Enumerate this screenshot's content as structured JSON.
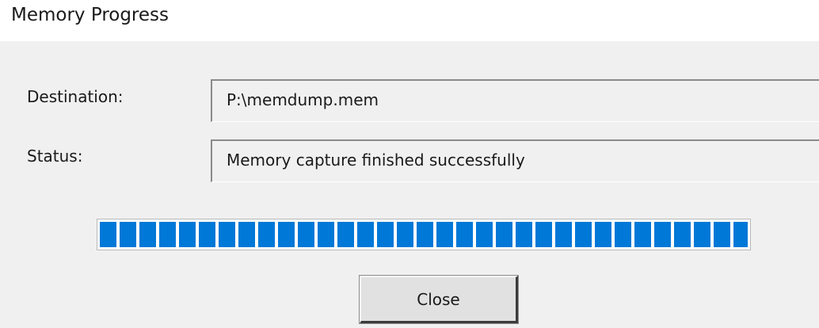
{
  "window": {
    "title": "Memory Progress"
  },
  "fields": {
    "destination": {
      "label": "Destination:",
      "value": "P:\\memdump.mem"
    },
    "status": {
      "label": "Status:",
      "value": "Memory capture finished successfully"
    }
  },
  "progress": {
    "fraction": 1.0
  },
  "buttons": {
    "close_label": "Close"
  },
  "colors": {
    "progress_fill": "#0078d7",
    "dialog_background": "#f0f0f0"
  }
}
